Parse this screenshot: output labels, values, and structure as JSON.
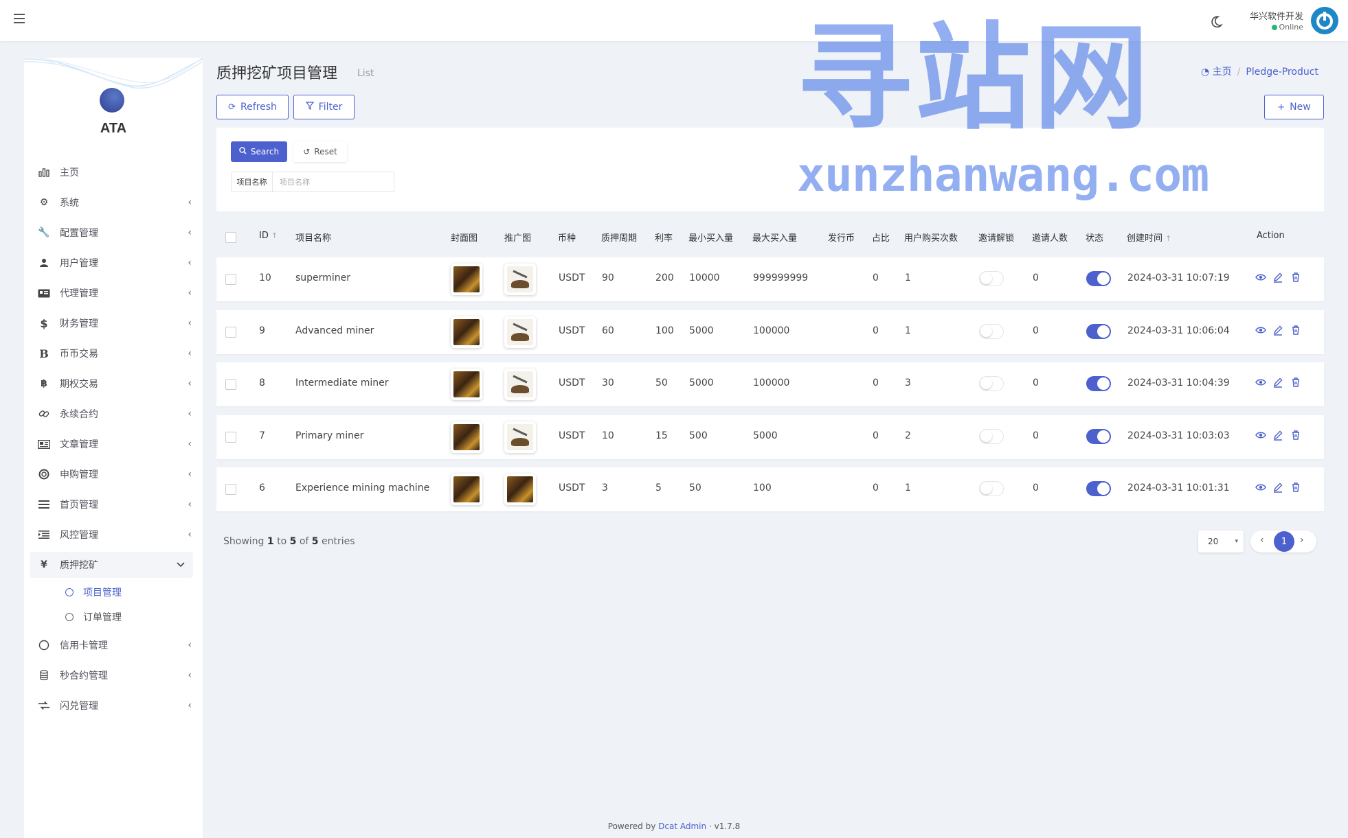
{
  "topbar": {
    "user_name": "华兴软件开发",
    "user_status": "Online"
  },
  "sidebar": {
    "logo_text": "ATA",
    "items": [
      {
        "label": "主页",
        "icon": "bar-chart-icon"
      },
      {
        "label": "系统",
        "icon": "gear-icon"
      },
      {
        "label": "配置管理",
        "icon": "wrench-icon"
      },
      {
        "label": "用户管理",
        "icon": "user-icon"
      },
      {
        "label": "代理管理",
        "icon": "id-card-icon"
      },
      {
        "label": "财务管理",
        "icon": "dollar-icon"
      },
      {
        "label": "币币交易",
        "icon": "bold-b-icon"
      },
      {
        "label": "期权交易",
        "icon": "bitcoin-icon"
      },
      {
        "label": "永续合约",
        "icon": "link-icon"
      },
      {
        "label": "文章管理",
        "icon": "newspaper-icon"
      },
      {
        "label": "申购管理",
        "icon": "life-ring-icon"
      },
      {
        "label": "首页管理",
        "icon": "list-icon"
      },
      {
        "label": "风控管理",
        "icon": "indent-icon"
      },
      {
        "label": "质押挖矿",
        "icon": "yen-icon"
      },
      {
        "label": "信用卡管理",
        "icon": "circle-icon"
      },
      {
        "label": "秒合约管理",
        "icon": "coins-icon"
      },
      {
        "label": "闪兑管理",
        "icon": "exchange-icon"
      }
    ],
    "sub_items": [
      {
        "label": "项目管理",
        "active": true
      },
      {
        "label": "订单管理",
        "active": false
      }
    ]
  },
  "header": {
    "title": "质押挖矿项目管理",
    "subtitle": "List",
    "breadcrumb_home": "主页",
    "breadcrumb_current": "Pledge-Product"
  },
  "toolbar": {
    "refresh_label": "Refresh",
    "filter_label": "Filter",
    "new_label": "New"
  },
  "filter": {
    "search_label": "Search",
    "reset_label": "Reset",
    "field_label": "项目名称",
    "field_placeholder": "项目名称"
  },
  "table": {
    "columns": [
      "ID",
      "项目名称",
      "封面图",
      "推广图",
      "币种",
      "质押周期",
      "利率",
      "最小买入量",
      "最大买入量",
      "发行币",
      "占比",
      "用户购买次数",
      "邀请解锁",
      "邀请人数",
      "状态",
      "创建时间",
      "Action"
    ],
    "rows": [
      {
        "id": "10",
        "name": "superminer",
        "currency": "USDT",
        "period": "90",
        "rate": "200",
        "min_buy": "10000",
        "max_buy": "999999999",
        "issue_coin": "",
        "ratio": "0",
        "purchases": "1",
        "invite_unlock": false,
        "invitees": "0",
        "status": true,
        "created": "2024-03-31 10:07:19",
        "promo_dark": false
      },
      {
        "id": "9",
        "name": "Advanced miner",
        "currency": "USDT",
        "period": "60",
        "rate": "100",
        "min_buy": "5000",
        "max_buy": "100000",
        "issue_coin": "",
        "ratio": "0",
        "purchases": "1",
        "invite_unlock": false,
        "invitees": "0",
        "status": true,
        "created": "2024-03-31 10:06:04",
        "promo_dark": false
      },
      {
        "id": "8",
        "name": "Intermediate miner",
        "currency": "USDT",
        "period": "30",
        "rate": "50",
        "min_buy": "5000",
        "max_buy": "100000",
        "issue_coin": "",
        "ratio": "0",
        "purchases": "3",
        "invite_unlock": false,
        "invitees": "0",
        "status": true,
        "created": "2024-03-31 10:04:39",
        "promo_dark": false
      },
      {
        "id": "7",
        "name": "Primary miner",
        "currency": "USDT",
        "period": "10",
        "rate": "15",
        "min_buy": "500",
        "max_buy": "5000",
        "issue_coin": "",
        "ratio": "0",
        "purchases": "2",
        "invite_unlock": false,
        "invitees": "0",
        "status": true,
        "created": "2024-03-31 10:03:03",
        "promo_dark": false
      },
      {
        "id": "6",
        "name": "Experience mining machine",
        "currency": "USDT",
        "period": "3",
        "rate": "5",
        "min_buy": "50",
        "max_buy": "100",
        "issue_coin": "",
        "ratio": "0",
        "purchases": "1",
        "invite_unlock": false,
        "invitees": "0",
        "status": true,
        "created": "2024-03-31 10:01:31",
        "promo_dark": true
      }
    ]
  },
  "pagination": {
    "showing_prefix": "Showing",
    "from": "1",
    "to_word": "to",
    "to": "5",
    "of_word": "of",
    "total": "5",
    "entries_word": "entries",
    "page_size": "20",
    "current_page": "1"
  },
  "footer": {
    "powered_by": "Powered by",
    "link": "Dcat Admin",
    "version": "v1.7.8"
  },
  "watermark": {
    "cn": "寻站网",
    "en": "xunzhanwang.com"
  },
  "colors": {
    "primary": "#4c60ce",
    "background": "#eff2f7",
    "online": "#21b978"
  }
}
